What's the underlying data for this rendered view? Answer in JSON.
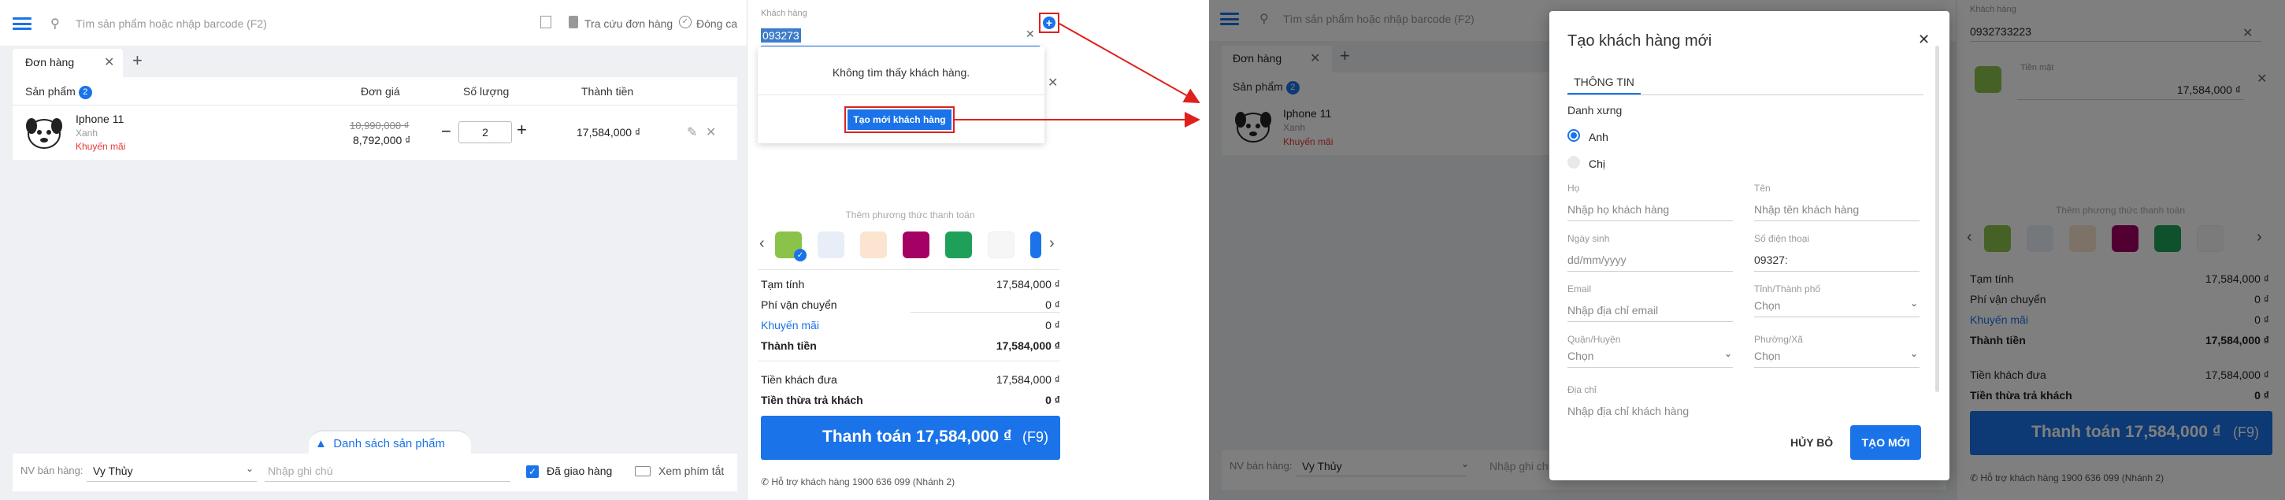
{
  "left": {
    "search_placeholder": "Tìm sản phẩm hoặc nhập barcode (F2)",
    "lookup_order": "Tra cứu đơn hàng",
    "close_shift": "Đóng ca",
    "tab_label": "Đơn hàng",
    "columns": {
      "product": "Sản phẩm",
      "product_count": "2",
      "price": "Đơn giá",
      "qty": "Số lượng",
      "total": "Thành tiền"
    },
    "item": {
      "name": "Iphone 11",
      "variant": "Xanh",
      "promo": "Khuyến mãi",
      "old_price": "10,990,000 ₫",
      "price": "8,792,000 ₫",
      "qty": "2",
      "total": "17,584,000 ₫"
    },
    "product_list_toggle": "Danh sách sản phẩm",
    "seller_label": "NV bán hàng:",
    "seller_value": "Vy Thủy",
    "note_placeholder": "Nhập ghi chú",
    "delivered_label": "Đã giao hàng",
    "shortcut_label": "Xem phím tắt",
    "customer_label": "Khách hàng",
    "customer_input": "093273",
    "not_found": "Không tìm thấy khách hàng.",
    "create_customer": "Tạo mới khách hàng",
    "add_payment": "Thêm phương thức thanh toán",
    "summary": [
      {
        "label": "Tạm tính",
        "value": "17,584,000 ₫"
      },
      {
        "label": "Phí vận chuyển",
        "value": "0 ₫"
      },
      {
        "label": "Khuyến mãi",
        "value": "0 ₫"
      },
      {
        "label": "Thành tiền",
        "value": "17,584,000 ₫"
      },
      {
        "label": "Tiền khách đưa",
        "value": "17,584,000 ₫"
      },
      {
        "label": "Tiền thừa trả khách",
        "value": "0 ₫"
      }
    ],
    "pay_button": "Thanh toán 17,584,000 ₫",
    "pay_key": "(F9)",
    "support": "Hỗ trợ khách hàng 1900 636 099 (Nhánh 2)"
  },
  "right": {
    "search_placeholder": "Tìm sản phẩm hoặc nhập barcode (F2)",
    "tab_label": "Đơn hàng",
    "product_header": "Sản phẩm",
    "product_count": "2",
    "item_name": "Iphone 11",
    "item_variant": "Xanh",
    "item_promo": "Khuyến mãi",
    "seller_label": "NV bán hàng:",
    "seller_value": "Vy Thủy",
    "note_placeholder": "Nhập ghi chú",
    "customer_label": "Khách hàng",
    "customer_value": "0932733223",
    "cash_label": "Tiền mặt",
    "cash_value": "17,584,000 ₫",
    "add_payment": "Thêm phương thức thanh toán",
    "summary": [
      {
        "label": "Tạm tính",
        "value": "17,584,000 ₫"
      },
      {
        "label": "Phí vận chuyển",
        "value": "0 ₫"
      },
      {
        "label": "Khuyến mãi",
        "value": "0 ₫"
      },
      {
        "label": "Thành tiền",
        "value": "17,584,000 ₫"
      },
      {
        "label": "Tiền khách đưa",
        "value": "17,584,000 ₫"
      },
      {
        "label": "Tiền thừa trả khách",
        "value": "0 ₫"
      }
    ],
    "pay_button": "Thanh toán 17,584,000 ₫",
    "pay_key": "(F9)",
    "support": "Hỗ trợ khách hàng 1900 636 099 (Nhánh 2)",
    "modal": {
      "title": "Tạo khách hàng mới",
      "tab": "THÔNG TIN",
      "salutation_label": "Danh xưng",
      "option1": "Anh",
      "option2": "Chị",
      "last_name_label": "Họ",
      "last_name_placeholder": "Nhập họ khách hàng",
      "first_name_label": "Tên",
      "first_name_placeholder": "Nhập tên khách hàng",
      "dob_label": "Ngày sinh",
      "dob_placeholder": "dd/mm/yyyy",
      "phone_label": "Số điện thoại",
      "phone_value": "09327:",
      "email_label": "Email",
      "email_placeholder": "Nhập địa chỉ email",
      "province_label": "Tỉnh/Thành phố",
      "province_value": "Chọn",
      "district_label": "Quận/Huyện",
      "district_value": "Chọn",
      "ward_label": "Phường/Xã",
      "ward_value": "Chọn",
      "address_label": "Địa chỉ",
      "address_placeholder": "Nhập địa chỉ khách hàng",
      "cancel": "HỦY BỎ",
      "create": "TẠO MỚI"
    }
  },
  "colors": {
    "accent": "#1a73e8",
    "promo": "#e53935",
    "annotation": "#e0201b",
    "pay_button": "#1a73e8"
  }
}
